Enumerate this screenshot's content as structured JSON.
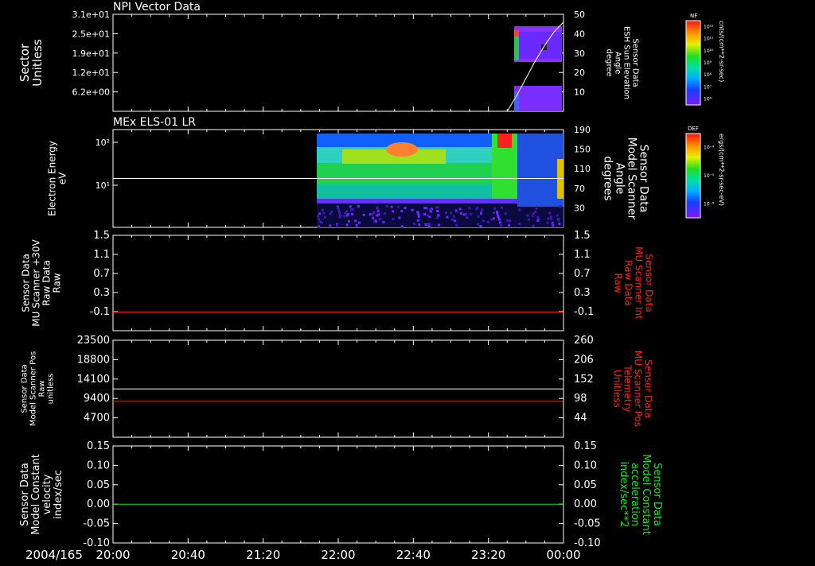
{
  "date_label": "2004/165",
  "time_ticks": [
    "20:00",
    "20:40",
    "21:20",
    "22:00",
    "22:40",
    "23:20",
    "00:00"
  ],
  "colors": {
    "white": "#ffffff",
    "red": "#ff2020",
    "green": "#20e020",
    "background": "#000000"
  },
  "chart_data": [
    {
      "type": "heatmap",
      "title": "NPI Vector Data",
      "ylabel_left": [
        "Sector",
        "Unitless"
      ],
      "ylabel_right": [
        "Sensor Data",
        "ESH Sun Elevation",
        "Angle",
        "degree"
      ],
      "left_ticks": [
        "3.1e+01",
        "2.5e+01",
        "1.9e+01",
        "1.2e+01",
        "6.2e+00"
      ],
      "right_ticks": [
        "50",
        "40",
        "30",
        "20",
        "10"
      ],
      "colorbar": {
        "label": "NF",
        "units": "cnts/(cm**2-sr-sec)",
        "ticks": [
          "10¹²",
          "10¹¹",
          "10¹⁰",
          "10⁹",
          "10⁸",
          "10⁷",
          "10⁶"
        ]
      },
      "data_start": "23:30",
      "line": {
        "name": "ESH Sun Elevation",
        "x": [
          "23:30",
          "23:35",
          "23:40",
          "23:45",
          "23:50",
          "23:55",
          "00:00"
        ],
        "y": [
          0,
          8,
          17,
          26,
          34,
          41,
          46
        ]
      }
    },
    {
      "type": "heatmap",
      "title": "MEx ELS-01 LR",
      "ylabel_left": [
        "Electron Energy",
        "eV"
      ],
      "ylabel_right": [
        "Sensor Data",
        "Model Scanner",
        "Angle",
        "degrees"
      ],
      "left_ticks": [
        "10²",
        "10¹"
      ],
      "right_ticks": [
        "190",
        "150",
        "110",
        "70",
        "30"
      ],
      "colorbar": {
        "label": "DEF",
        "units": "ergs/(cm**2-sr-sec-eV)",
        "ticks": [
          "10⁻⁴",
          "10⁻⁵",
          "10⁻⁶"
        ]
      },
      "data_start": "21:50",
      "line": {
        "name": "Model Scanner Angle",
        "x": [
          "20:00",
          "00:00"
        ],
        "y": [
          90,
          90
        ]
      }
    },
    {
      "type": "line",
      "ylabel_left": [
        "Sensor Data",
        "MU Scanner +30V",
        "Raw Data",
        "Raw"
      ],
      "ylabel_right": [
        "Sensor Data",
        "MU Scanner Int",
        "Raw Data",
        "Raw"
      ],
      "left_ticks": [
        "1.5",
        "1.1",
        "0.7",
        "0.3",
        "-0.1"
      ],
      "right_ticks": [
        "1.5",
        "1.1",
        "0.7",
        "0.3",
        "-0.1"
      ],
      "ylim": [
        -0.3,
        1.5
      ],
      "series": [
        {
          "name": "MU Scanner Int",
          "color": "red",
          "x": [
            "20:00",
            "00:00"
          ],
          "y": [
            0.05,
            0.05
          ]
        }
      ]
    },
    {
      "type": "line",
      "ylabel_left": [
        "Sensor Data",
        "Model Scanner Pos",
        "Raw",
        "unitless"
      ],
      "ylabel_right": [
        "Sensor Data",
        "MU Scanner Pos",
        "Telemetry",
        "Unitless"
      ],
      "left_ticks": [
        "23500",
        "18800",
        "14100",
        "9400",
        "4700"
      ],
      "right_ticks": [
        "260",
        "206",
        "152",
        "98",
        "44"
      ],
      "ylim": [
        0,
        23500
      ],
      "series": [
        {
          "name": "Model Scanner Pos",
          "color": "white",
          "x": [
            "20:00",
            "00:00"
          ],
          "y": [
            11700,
            11700
          ]
        },
        {
          "name": "MU Scanner Pos",
          "color": "red",
          "x": [
            "20:00",
            "00:00"
          ],
          "y": [
            8700,
            8700
          ]
        }
      ]
    },
    {
      "type": "line",
      "ylabel_left": [
        "Sensor Data",
        "Model Constant",
        "velocity",
        "index/sec"
      ],
      "ylabel_right": [
        "Sensor Data",
        "Model Constant",
        "acceleration",
        "index/sec**2"
      ],
      "left_ticks": [
        "0.15",
        "0.10",
        "0.05",
        "0.00",
        "-0.05",
        "-0.10"
      ],
      "right_ticks": [
        "0.15",
        "0.10",
        "0.05",
        "0.00",
        "-0.05",
        "-0.10"
      ],
      "ylim": [
        -0.1,
        0.15
      ],
      "series": [
        {
          "name": "Model Constant",
          "color": "green",
          "x": [
            "20:00",
            "00:00"
          ],
          "y": [
            0,
            0
          ]
        }
      ]
    }
  ]
}
